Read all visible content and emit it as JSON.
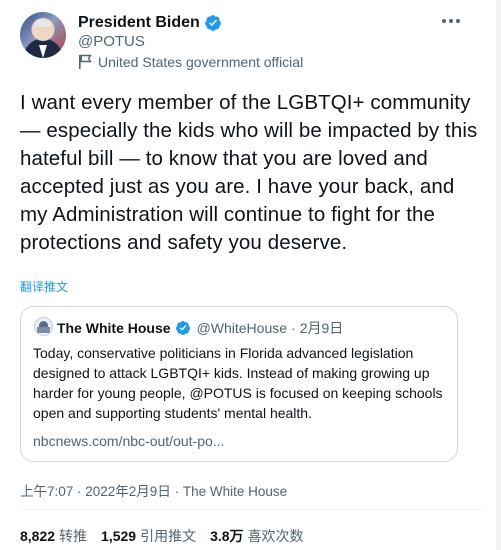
{
  "author": {
    "name": "President Biden",
    "handle": "@POTUS",
    "label": "United States government official"
  },
  "tweet": {
    "text": "I want every member of the LGBTQI+ community — especially the kids who will be impacted by this hateful bill — to know that you are loved and accepted just as you are. I have your back, and my Administration will continue to fight for the protections and safety you deserve.",
    "translate": "翻译推文",
    "timestamp": "上午7:07 · 2022年2月9日 · The White House"
  },
  "quote": {
    "name": "The White House",
    "handle": "@WhiteHouse",
    "sep": "·",
    "date": "2月9日",
    "text": "Today, conservative politicians in Florida advanced legislation designed to attack LGBTQI+ kids. Instead of making growing up harder for young people, @POTUS is focused on keeping schools open and supporting students' mental health.",
    "link": "nbcnews.com/nbc-out/out-po..."
  },
  "stats": {
    "retweets": {
      "count": "8,822",
      "label": "转推"
    },
    "quotes": {
      "count": "1,529",
      "label": "引用推文"
    },
    "likes": {
      "count": "3.8万",
      "label": "喜欢次数"
    }
  },
  "colors": {
    "accent": "#1d9bf0",
    "secondary_text": "#536471",
    "border": "#cfd9de"
  },
  "icons": [
    "verified-badge-icon",
    "government-flag-icon",
    "more-options-icon"
  ]
}
